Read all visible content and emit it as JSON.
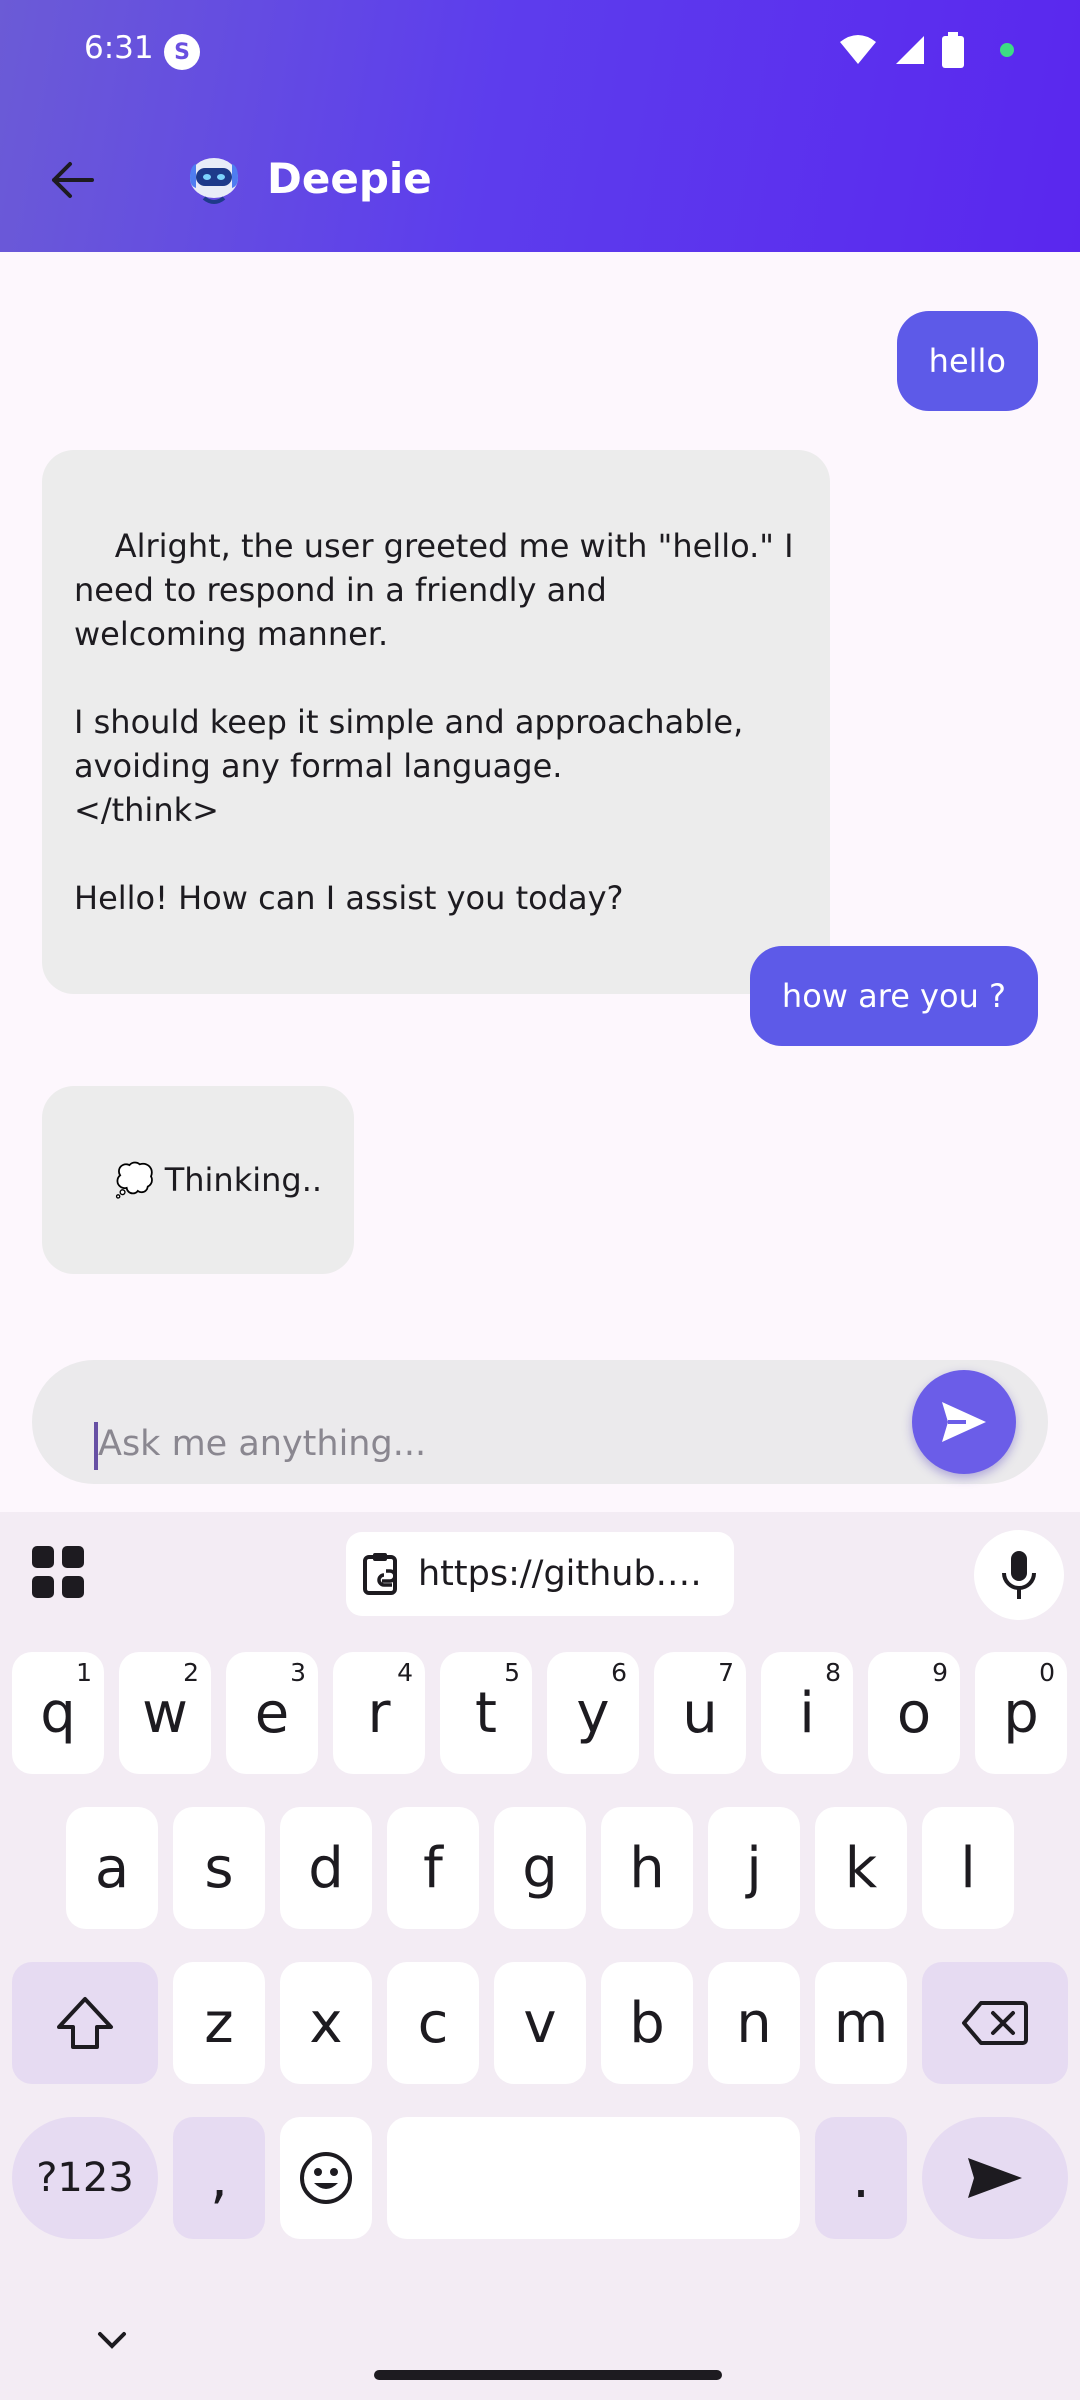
{
  "status_bar": {
    "time": "6:31",
    "s_icon": "S"
  },
  "header": {
    "title": "Deepie",
    "back_icon": "arrow-left-icon",
    "logo_icon": "robot-icon"
  },
  "messages": [
    {
      "role": "user",
      "text": "hello"
    },
    {
      "role": "bot",
      "text": "Alright, the user greeted me with \"hello.\" I\nneed to respond in a friendly and\nwelcoming manner.\n\nI should keep it simple and approachable,\navoiding any formal language.\n</think>\n\nHello! How can I assist you today?"
    },
    {
      "role": "user",
      "text": "how are you ?"
    },
    {
      "role": "bot",
      "text": "💭 Thinking.."
    }
  ],
  "input": {
    "placeholder": "Ask me anything..."
  },
  "keyboard": {
    "clipboard_text": "https://github.…",
    "row1": [
      {
        "k": "q",
        "h": "1"
      },
      {
        "k": "w",
        "h": "2"
      },
      {
        "k": "e",
        "h": "3"
      },
      {
        "k": "r",
        "h": "4"
      },
      {
        "k": "t",
        "h": "5"
      },
      {
        "k": "y",
        "h": "6"
      },
      {
        "k": "u",
        "h": "7"
      },
      {
        "k": "i",
        "h": "8"
      },
      {
        "k": "o",
        "h": "9"
      },
      {
        "k": "p",
        "h": "0"
      }
    ],
    "row2": [
      "a",
      "s",
      "d",
      "f",
      "g",
      "h",
      "j",
      "k",
      "l"
    ],
    "row3": [
      "z",
      "x",
      "c",
      "v",
      "b",
      "n",
      "m"
    ],
    "symbols_label": "?123",
    "comma": ",",
    "period": "."
  },
  "colors": {
    "accent": "#5d5ae8",
    "header_start": "#6b5bd6",
    "header_end": "#5a27ee",
    "bot_bubble": "#ececec"
  }
}
